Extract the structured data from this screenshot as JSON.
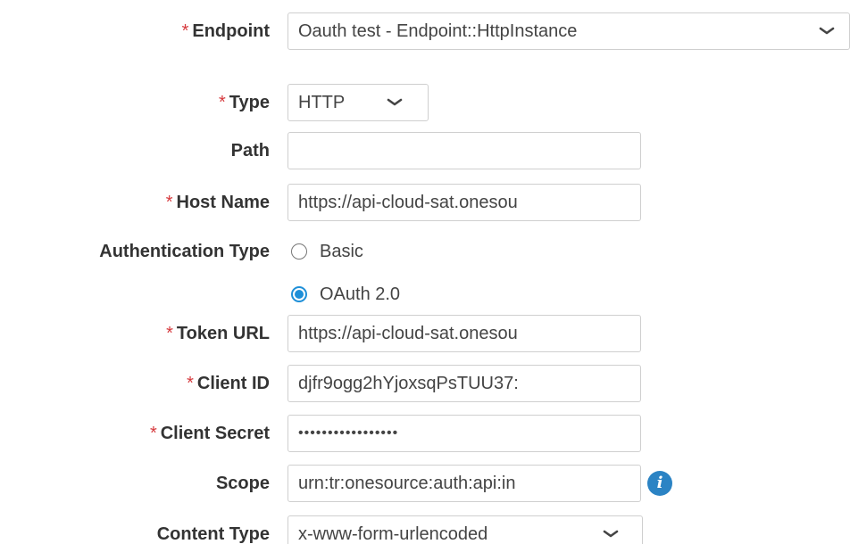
{
  "form": {
    "endpoint": {
      "label": "Endpoint",
      "value": "Oauth test - Endpoint::HttpInstance"
    },
    "type": {
      "label": "Type",
      "value": "HTTP"
    },
    "path": {
      "label": "Path",
      "value": ""
    },
    "host_name": {
      "label": "Host Name",
      "value": "https://api-cloud-sat.onesou"
    },
    "authentication_type": {
      "label": "Authentication Type",
      "options": [
        {
          "label": "Basic",
          "selected": false
        },
        {
          "label": "OAuth 2.0",
          "selected": true
        }
      ]
    },
    "token_url": {
      "label": "Token URL",
      "value": "https://api-cloud-sat.onesou"
    },
    "client_id": {
      "label": "Client ID",
      "value": "djfr9ogg2hYjoxsqPsTUU37:"
    },
    "client_secret": {
      "label": "Client Secret",
      "value": "•••••••••••••••••"
    },
    "scope": {
      "label": "Scope",
      "value": "urn:tr:onesource:auth:api:in",
      "info_icon": "info-icon"
    },
    "content_type": {
      "label": "Content Type",
      "value": "x-www-form-urlencoded"
    },
    "required_marker": "*"
  },
  "colors": {
    "required": "#d6393d",
    "accent": "#1e8fd8",
    "info": "#2b83c4",
    "border": "#cfcfcf"
  }
}
